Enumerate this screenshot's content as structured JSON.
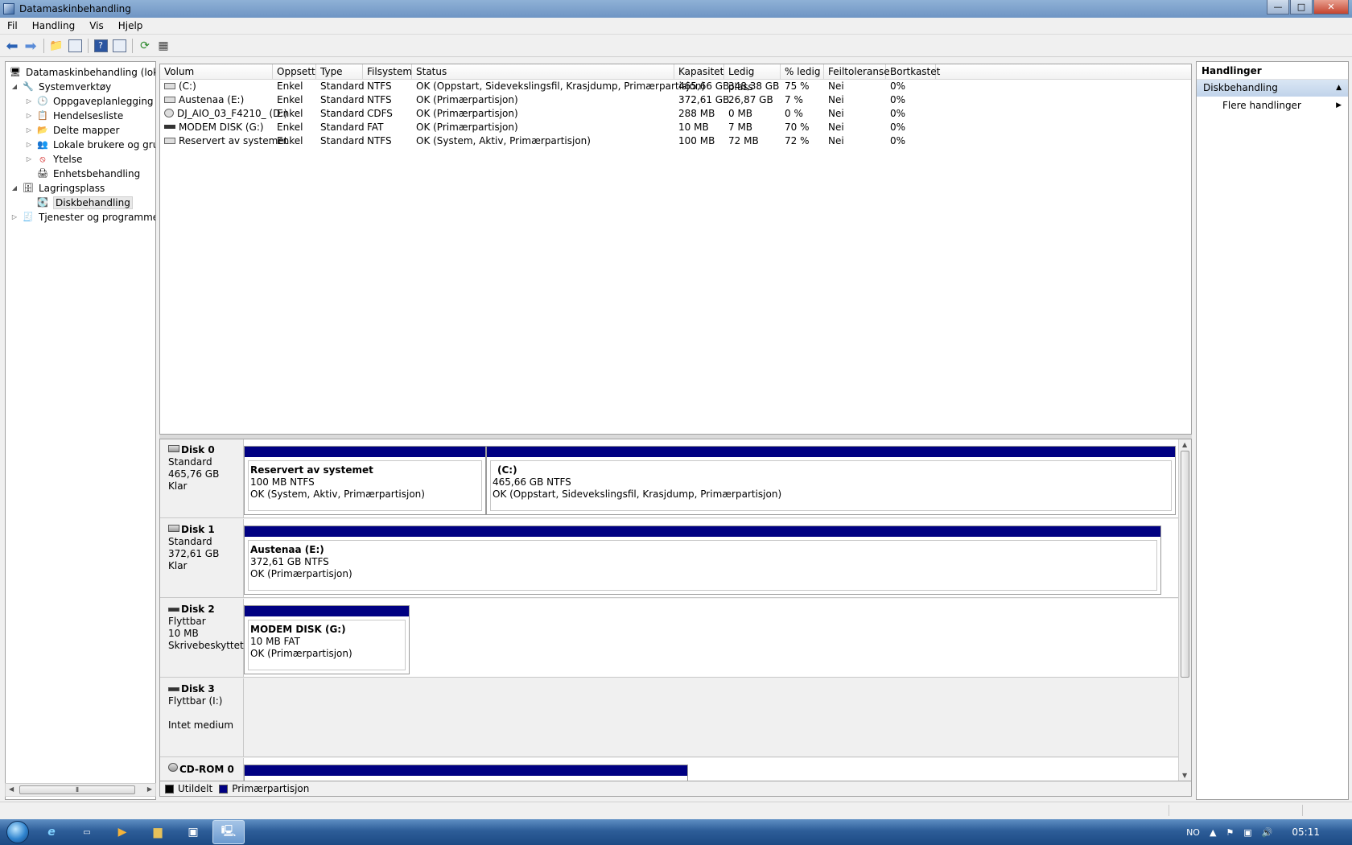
{
  "window": {
    "title": "Datamaskinbehandling",
    "buttons": {
      "minimize": "—",
      "maximize": "□",
      "close": "✕"
    }
  },
  "menu": [
    "Fil",
    "Handling",
    "Vis",
    "Hjelp"
  ],
  "tree": {
    "root": "Datamaskinbehandling (lokal)",
    "systemtools": "Systemverktøy",
    "task_scheduler": "Oppgaveplanlegging",
    "event_viewer": "Hendelsesliste",
    "shared_folders": "Delte mapper",
    "local_users": "Lokale brukere og grupp",
    "performance": "Ytelse",
    "device_manager": "Enhetsbehandling",
    "storage": "Lagringsplass",
    "disk_management": "Diskbehandling",
    "services": "Tjenester og programmer"
  },
  "columns": [
    "Volum",
    "Oppsett",
    "Type",
    "Filsystem",
    "Status",
    "Kapasitet",
    "Ledig plass",
    "% ledig",
    "Feiltoleranse",
    "Bortkastet"
  ],
  "volumes": [
    {
      "volume": "(C:)",
      "layout": "Enkel",
      "type": "Standard",
      "fs": "NTFS",
      "status": "OK (Oppstart, Sidevekslingsfil, Krasjdump, Primærpartisjon)",
      "capacity": "465,66 GB",
      "free": "348,38 GB",
      "pct": "75 %",
      "fault": "Nei",
      "overhead": "0%"
    },
    {
      "volume": "Austenaa (E:)",
      "layout": "Enkel",
      "type": "Standard",
      "fs": "NTFS",
      "status": "OK (Primærpartisjon)",
      "capacity": "372,61 GB",
      "free": "26,87 GB",
      "pct": "7 %",
      "fault": "Nei",
      "overhead": "0%"
    },
    {
      "volume": "DJ_AIO_03_F4210_ (D:)",
      "layout": "Enkel",
      "type": "Standard",
      "fs": "CDFS",
      "status": "OK (Primærpartisjon)",
      "capacity": "288 MB",
      "free": "0 MB",
      "pct": "0 %",
      "fault": "Nei",
      "overhead": "0%"
    },
    {
      "volume": "MODEM DISK (G:)",
      "layout": "Enkel",
      "type": "Standard",
      "fs": "FAT",
      "status": "OK (Primærpartisjon)",
      "capacity": "10 MB",
      "free": "7 MB",
      "pct": "70 %",
      "fault": "Nei",
      "overhead": "0%"
    },
    {
      "volume": "Reservert av systemet",
      "layout": "Enkel",
      "type": "Standard",
      "fs": "NTFS",
      "status": "OK (System, Aktiv, Primærpartisjon)",
      "capacity": "100 MB",
      "free": "72 MB",
      "pct": "72 %",
      "fault": "Nei",
      "overhead": "0%"
    }
  ],
  "disks": {
    "d0": {
      "name": "Disk 0",
      "kind": "Standard",
      "size": "465,76 GB",
      "state": "Klar",
      "p1": {
        "title": "Reservert av systemet",
        "size": "100 MB NTFS",
        "status": "OK (System, Aktiv, Primærpartisjon)"
      },
      "p2": {
        "title": "(C:)",
        "size": "465,66 GB NTFS",
        "status": "OK (Oppstart, Sidevekslingsfil, Krasjdump, Primærpartisjon)"
      }
    },
    "d1": {
      "name": "Disk 1",
      "kind": "Standard",
      "size": "372,61 GB",
      "state": "Klar",
      "p1": {
        "title": "Austenaa  (E:)",
        "size": "372,61 GB NTFS",
        "status": "OK (Primærpartisjon)"
      }
    },
    "d2": {
      "name": "Disk 2",
      "kind": "Flyttbar",
      "size": "10 MB",
      "state": "Skrivebeskyttet",
      "p1": {
        "title": "MODEM DISK  (G:)",
        "size": "10 MB FAT",
        "status": "OK (Primærpartisjon)"
      }
    },
    "d3": {
      "name": "Disk 3",
      "kind": "Flyttbar (I:)",
      "state": "Intet medium"
    },
    "cd": {
      "name": "CD-ROM 0"
    }
  },
  "legend": {
    "unallocated": "Utildelt",
    "primary": "Primærpartisjon",
    "unallocated_color": "#000000",
    "primary_color": "#000082"
  },
  "actions": {
    "header": "Handlinger",
    "section": "Diskbehandling",
    "more": "Flere handlinger"
  },
  "tray": {
    "lang": "NO",
    "time": "05:11"
  }
}
